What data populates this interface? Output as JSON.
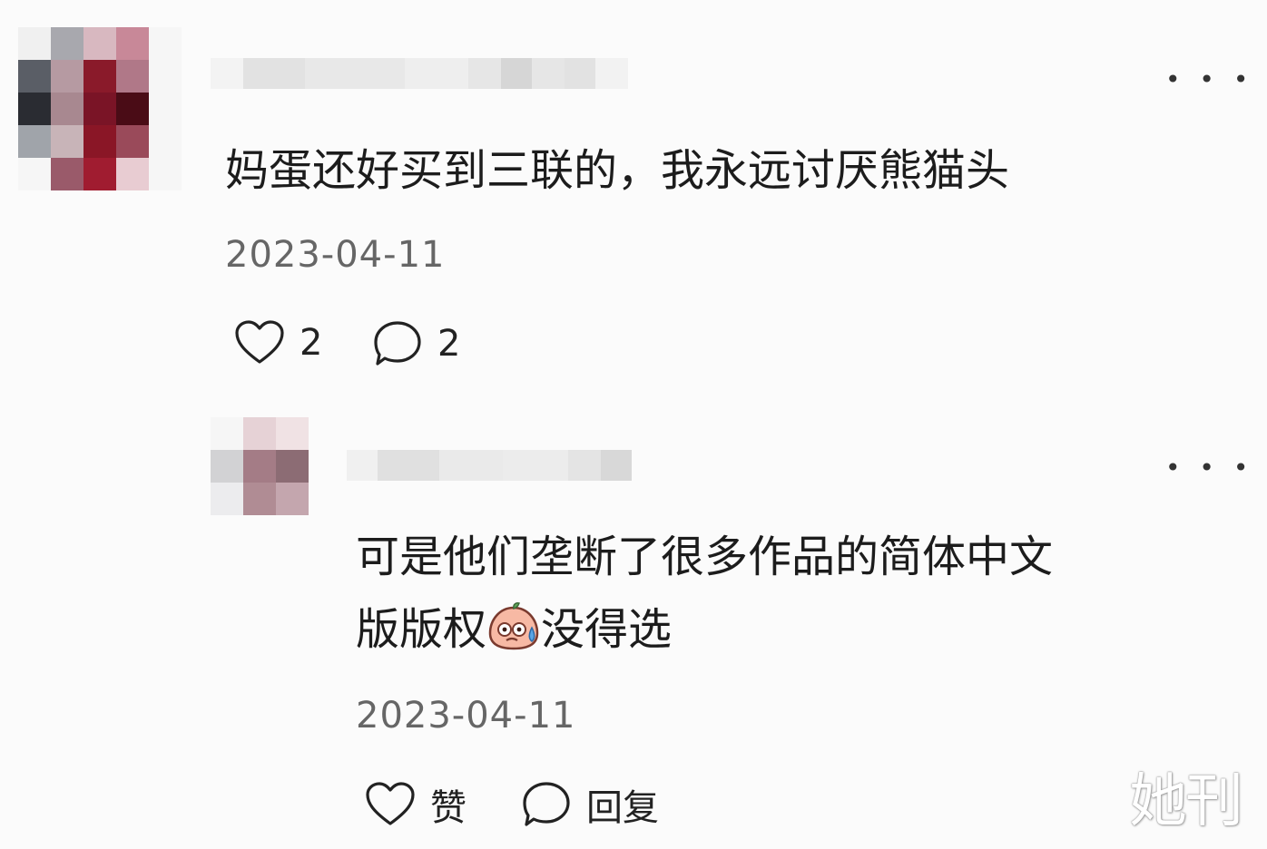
{
  "comments": [
    {
      "text": "妈蛋还好买到三联的，我永远讨厌熊猫头",
      "date": "2023-04-11",
      "like_count": "2",
      "reply_count": "2",
      "avatar_colors": [
        [
          "#f0f0f0",
          "#a8a8ae",
          "#d8b8c0",
          "#c88898",
          "#f6f6f6"
        ],
        [
          "#5a5e66",
          "#b69aa2",
          "#8a1a2a",
          "#b07888",
          "#f6f6f6"
        ],
        [
          "#2a2c32",
          "#a88890",
          "#7a1426",
          "#4a0c16",
          "#f6f6f6"
        ],
        [
          "#a0a4aa",
          "#c8b4b8",
          "#8a1626",
          "#9a4a5a",
          "#f6f6f6"
        ],
        [
          "#f6f6f6",
          "#9a5a6a",
          "#a01c30",
          "#e8ccd2",
          "#f6f6f6"
        ]
      ]
    },
    {
      "text_line1": "可是他们垄断了很多作品的简体中文",
      "text_line2_a": "版版权",
      "emoji": "sweat-face-emoji",
      "text_line2_b": "没得选",
      "date": "2023-04-11",
      "like_label": "赞",
      "reply_label": "回复",
      "avatar_colors": [
        [
          "#f6f6f6",
          "#e6d2d6",
          "#f0e2e4"
        ],
        [
          "#d2d2d4",
          "#a47c86",
          "#8c6c74"
        ],
        [
          "#ececee",
          "#b08c94",
          "#c4a6ae"
        ]
      ]
    }
  ],
  "more_label": "• • •",
  "watermark": "她刊"
}
